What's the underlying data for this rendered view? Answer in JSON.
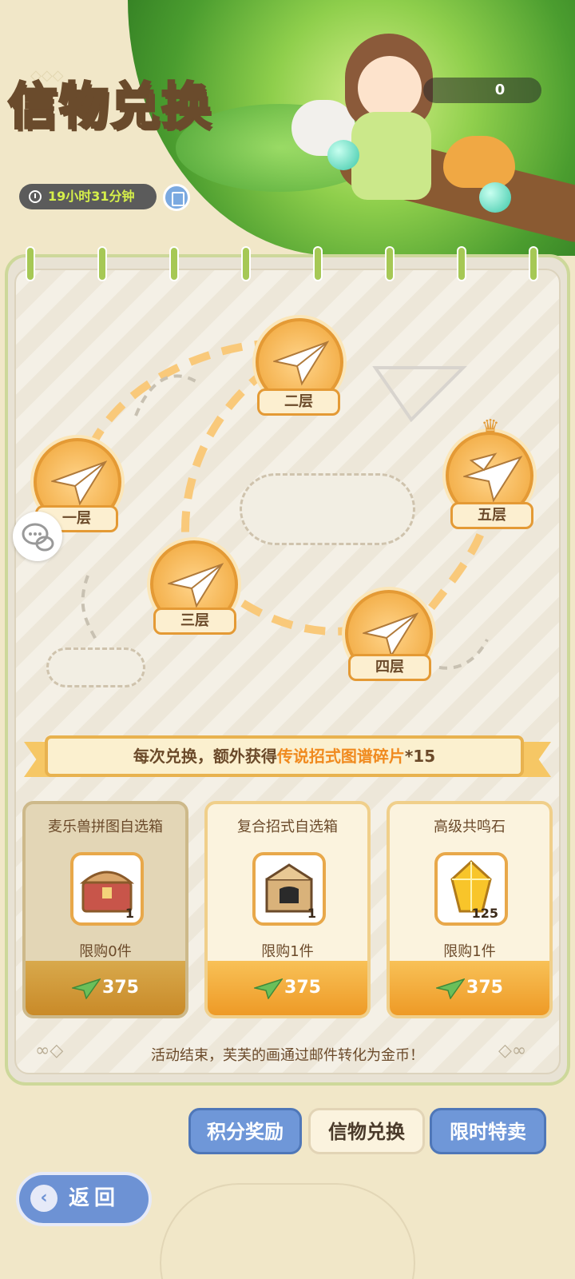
{
  "header": {
    "title": "信物兑换",
    "timer": "19小时31分钟",
    "score": "0"
  },
  "map": {
    "nodes": [
      {
        "label": "一层"
      },
      {
        "label": "二层"
      },
      {
        "label": "三层"
      },
      {
        "label": "四层"
      },
      {
        "label": "五层"
      }
    ]
  },
  "banner": {
    "prefix": "每次兑换，额外获得",
    "highlight": "传说招式图谱碎片",
    "suffix": "*15"
  },
  "shop": {
    "items": [
      {
        "name": "麦乐兽拼图自选箱",
        "qty": "1",
        "limit": "限购0件",
        "price": "375",
        "icon": "chest-icon"
      },
      {
        "name": "复合招式自选箱",
        "qty": "1",
        "limit": "限购1件",
        "price": "375",
        "icon": "crate-icon"
      },
      {
        "name": "高级共鸣石",
        "qty": "125",
        "limit": "限购1件",
        "price": "375",
        "icon": "gem-icon"
      }
    ]
  },
  "footer_note": "活动结束，芙芙的画通过邮件转化为金币！",
  "tabs": [
    {
      "label": "积分奖励"
    },
    {
      "label": "信物兑换"
    },
    {
      "label": "限时特卖"
    }
  ],
  "back_button": {
    "label": "返回"
  },
  "colors": {
    "accent_orange": "#f08a1f",
    "tab_blue": "#6f97d8",
    "ring_green": "#a6c855"
  }
}
